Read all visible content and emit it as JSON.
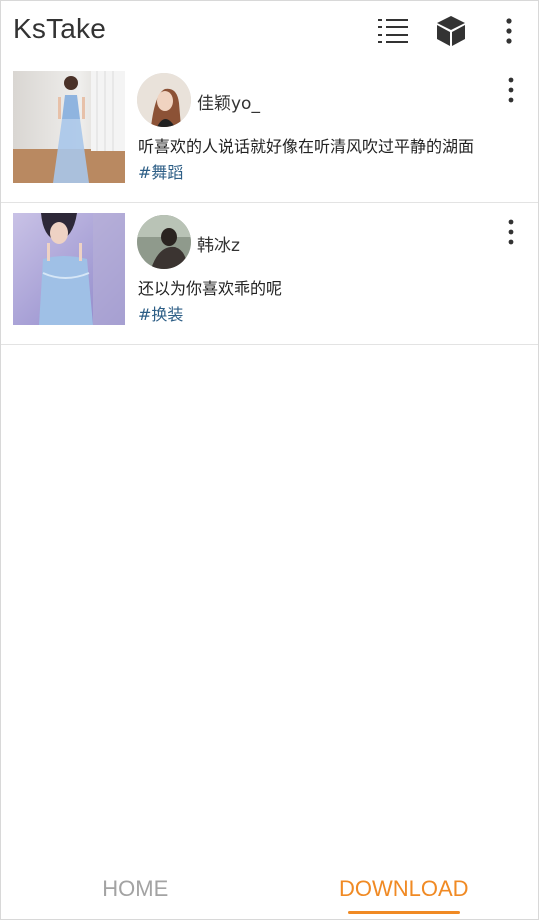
{
  "app": {
    "title": "KsTake",
    "icons": [
      "list-icon",
      "cube-icon",
      "more-vertical-icon"
    ]
  },
  "feed": {
    "items": [
      {
        "username": "佳颖yo_",
        "caption": "听喜欢的人说话就好像在听清风吹过平静的湖面",
        "tag": "#舞蹈"
      },
      {
        "username": "韩冰z",
        "caption": "还以为你喜欢乖的呢",
        "tag": "#换装"
      }
    ]
  },
  "bottom_nav": {
    "tabs": [
      {
        "label": "HOME",
        "active": false
      },
      {
        "label": "DOWNLOAD",
        "active": true
      }
    ],
    "colors": {
      "active": "#f08a24",
      "inactive": "#a3a3a3"
    }
  },
  "colors": {
    "tag": "#2d5e86",
    "accent": "#f08a24"
  }
}
